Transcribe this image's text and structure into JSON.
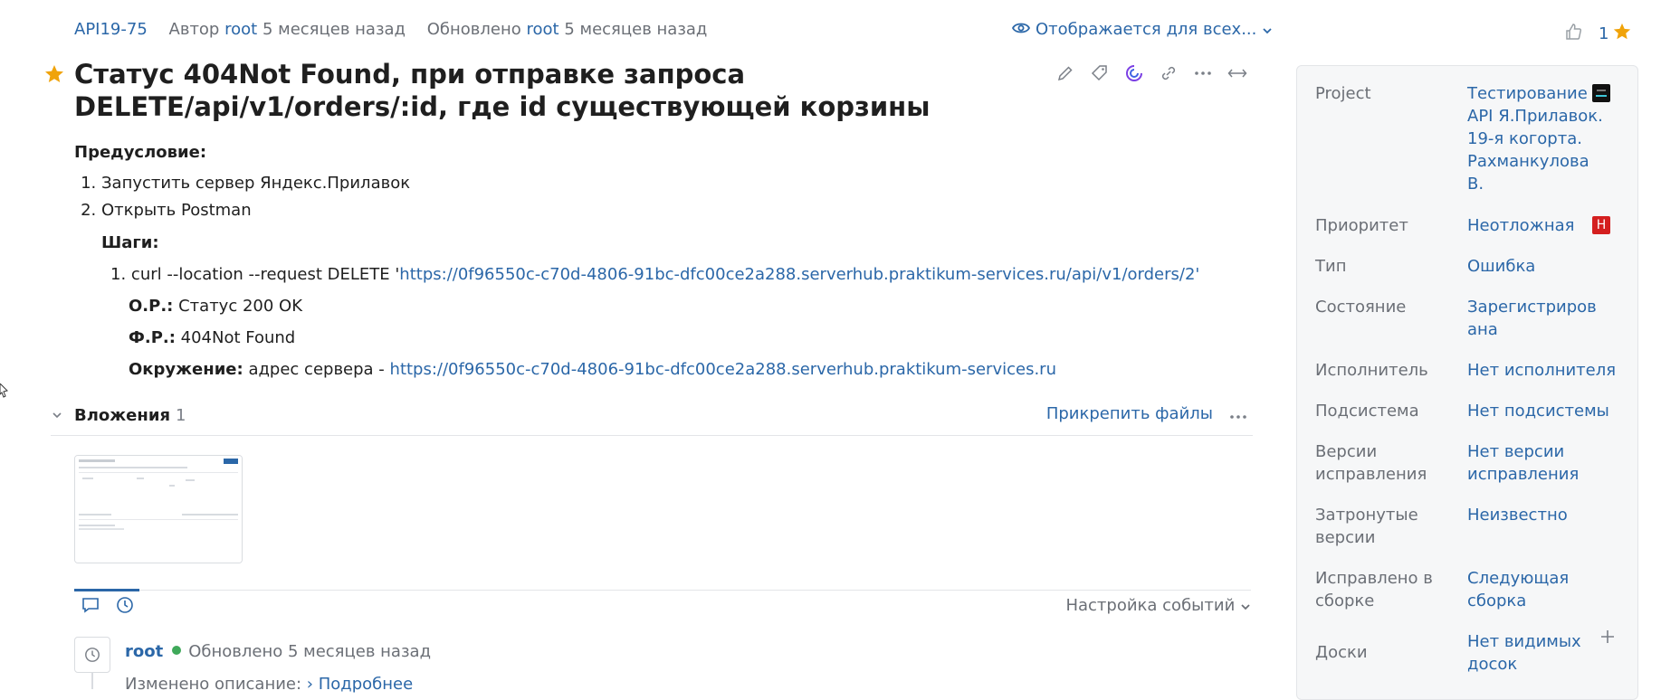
{
  "header": {
    "issue_id": "API19-75",
    "author_prefix": "Автор",
    "author": "root",
    "created": "5 месяцев назад",
    "updated_prefix": "Обновлено",
    "updater": "root",
    "updated": "5 месяцев назад",
    "visibility": "Отображается для всех...",
    "like_count": "1"
  },
  "issue": {
    "title": "Статус 404Not Found, при отправке запроса DELETE/api/v1/orders/:id, где id существующей корзины",
    "starred": true
  },
  "description": {
    "precondition_heading": "Предусловие:",
    "preconditions": [
      "Запустить сервер Яндекс.Прилавок",
      "Открыть Postman"
    ],
    "steps_heading": "Шаги:",
    "step_number": "1.",
    "step_prefix": "curl --location --request DELETE '",
    "step_url": "https://0f96550c-c70d-4806-91bc-dfc00ce2a288.serverhub.praktikum-services.ru/api/v1/orders/2'",
    "expected_label": "О.Р.:",
    "expected_value": "Статус 200 OK",
    "actual_label": "Ф.Р.:",
    "actual_value": "404Not Found",
    "env_label": "Окружение:",
    "env_prefix": "адрес сервера - ",
    "env_url": "https://0f96550c-c70d-4806-91bc-dfc00ce2a288.serverhub.praktikum-services.ru"
  },
  "attachments": {
    "label": "Вложения",
    "count": "1",
    "attach_button": "Прикрепить файлы"
  },
  "activity": {
    "settings": "Настройка событий",
    "event_user": "root",
    "event_text": "Обновлено 5 месяцев назад",
    "event_detail": "Изменено описание:",
    "event_more": "Подробнее"
  },
  "sidebar": {
    "project_label": "Project",
    "project_value": "Тестирование API Я.Прилавок. 19-я когорта. Рахманкулова В.",
    "priority_label": "Приоритет",
    "priority_value": "Неотложная",
    "priority_badge": "Н",
    "type_label": "Тип",
    "type_value": "Ошибка",
    "state_label": "Состояние",
    "state_value": "Зарегистрирована",
    "assignee_label": "Исполнитель",
    "assignee_value": "Нет исполнителя",
    "subsystem_label": "Подсистема",
    "subsystem_value": "Нет подсистемы",
    "fix_versions_label": "Версии исправления",
    "fix_versions_value": "Нет версии исправления",
    "affected_label": "Затронутые версии",
    "affected_value": "Неизвестно",
    "fixed_build_label": "Исправлено в сборке",
    "fixed_build_value": "Следующая сборка",
    "boards_label": "Доски",
    "boards_value": "Нет видимых досок"
  },
  "colors": {
    "accent": "#2b67a8",
    "star": "#f0a30a",
    "priority_badge": "#d41f1f",
    "online": "#3fa95a"
  }
}
